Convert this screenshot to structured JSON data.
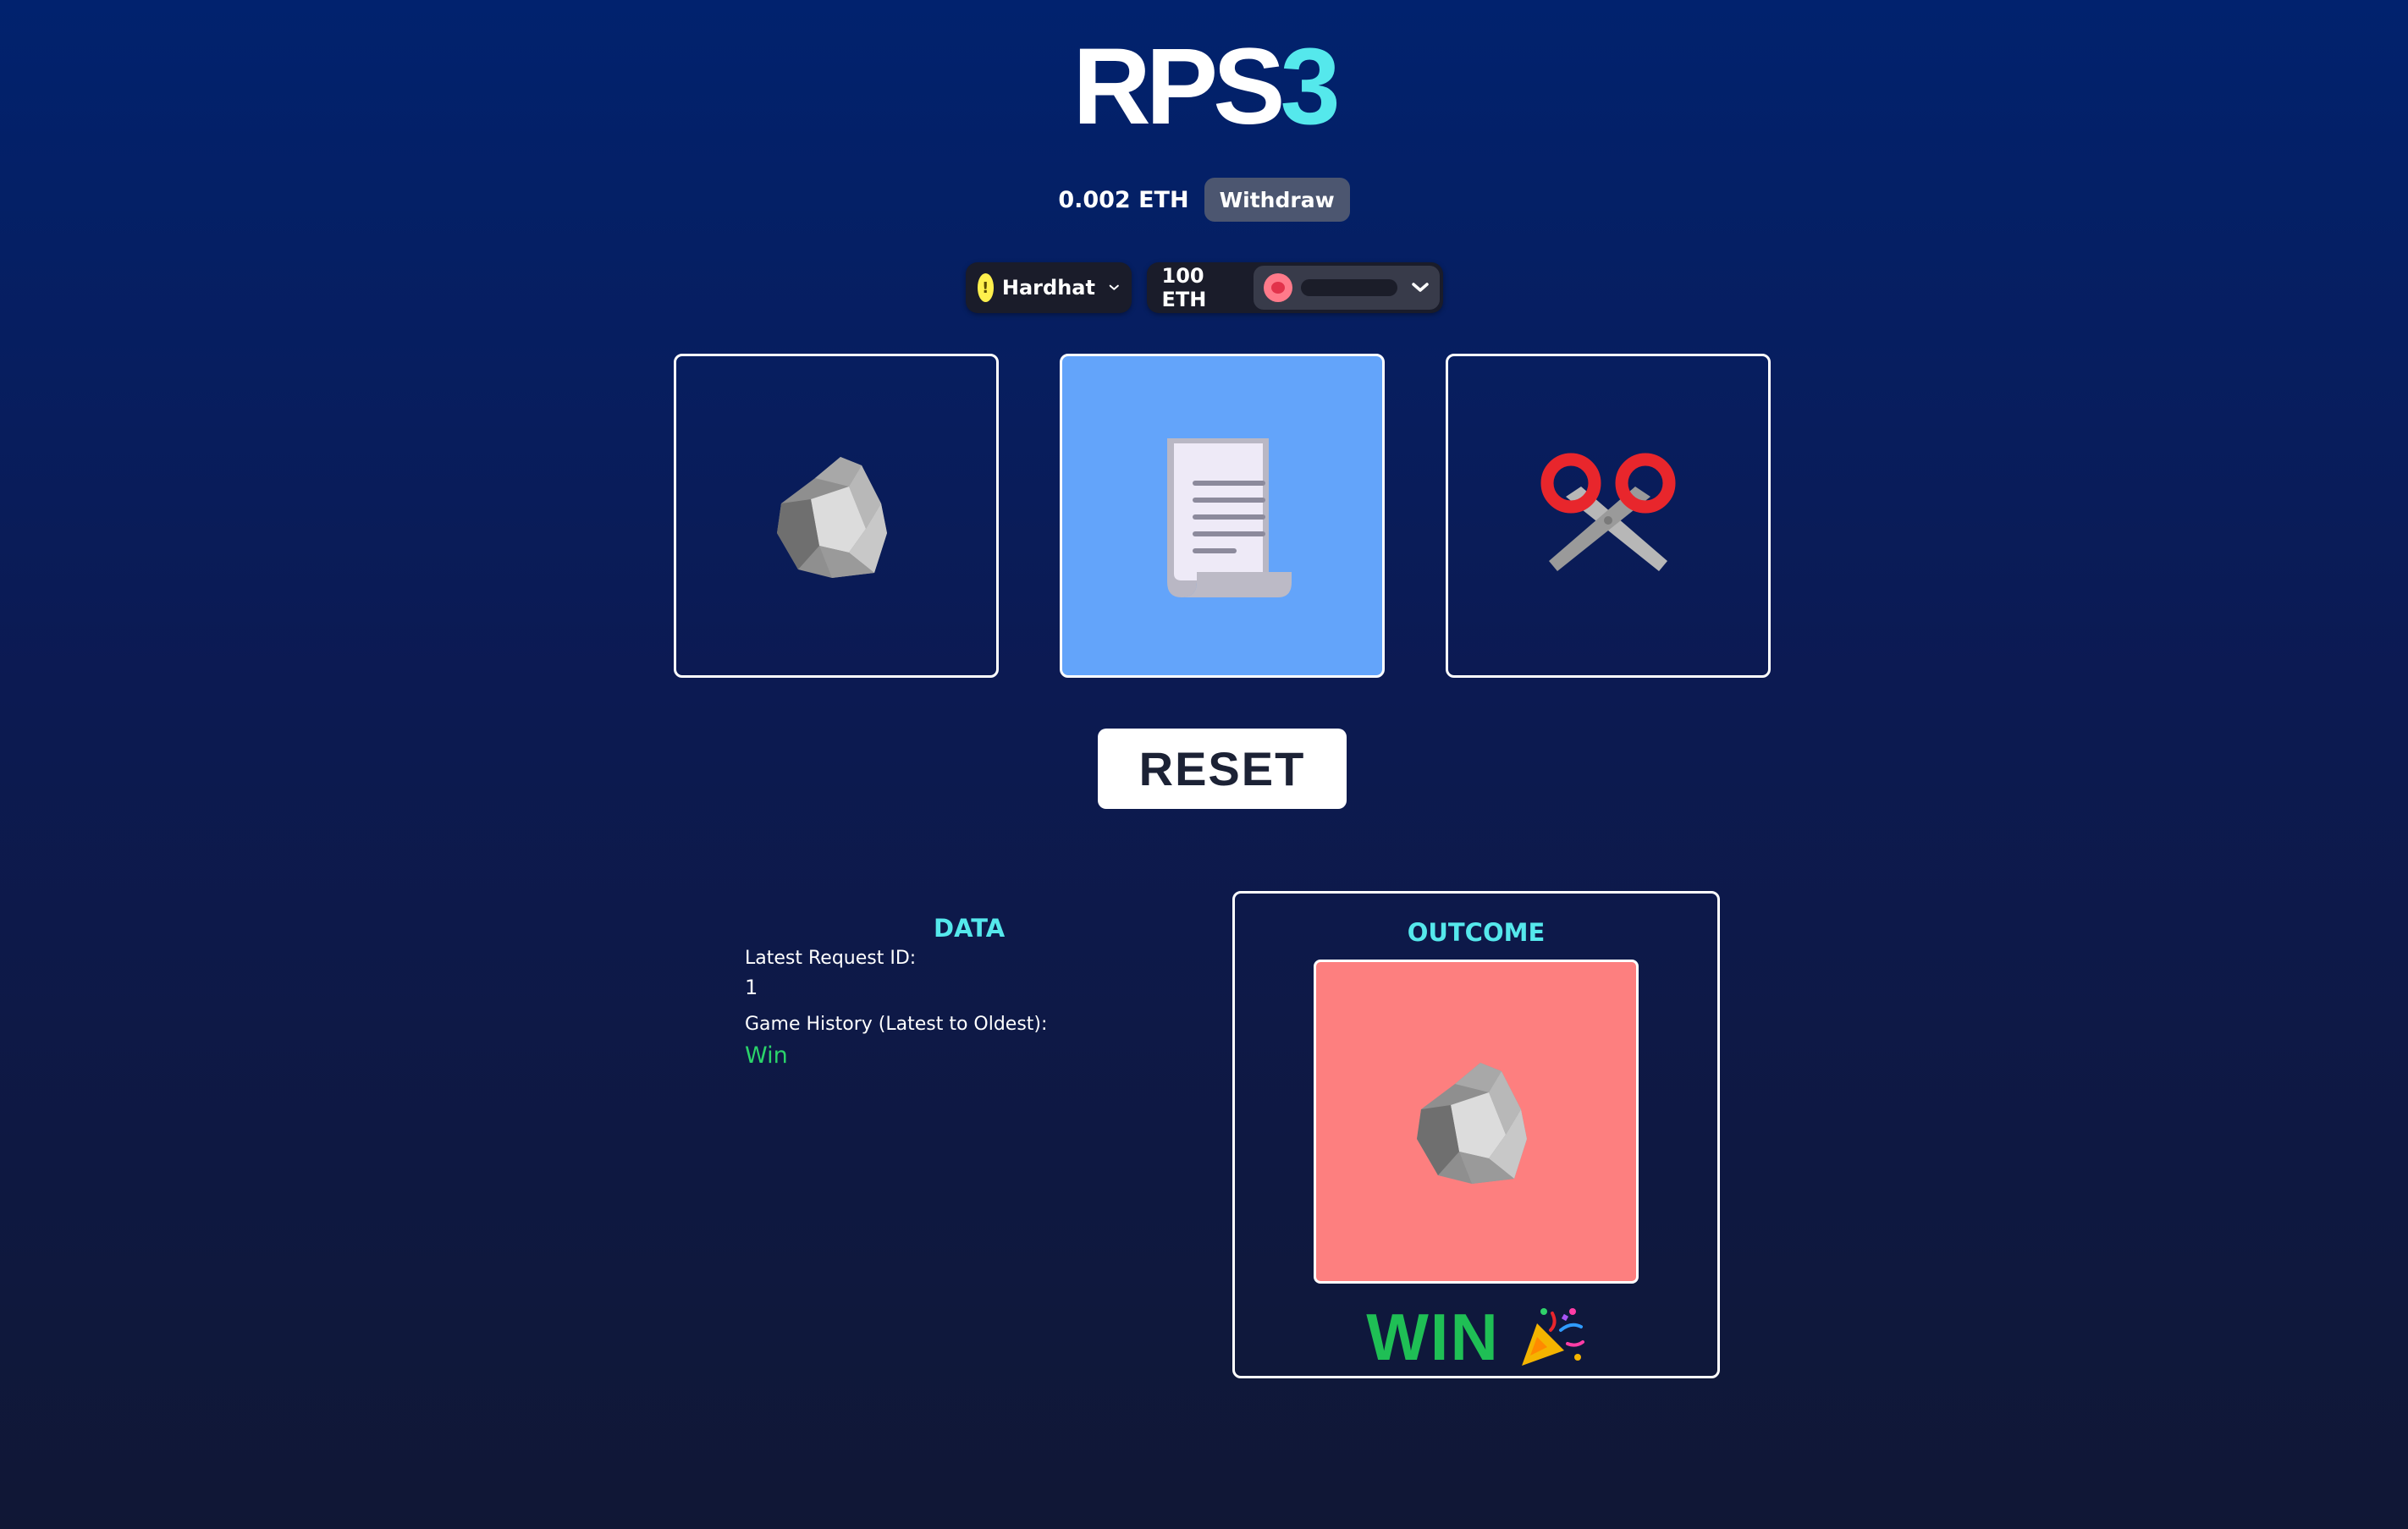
{
  "header": {
    "title_main": "RPS",
    "title_accent": "3"
  },
  "balance": {
    "amount": "0.002 ETH",
    "withdraw_label": "Withdraw"
  },
  "wallet": {
    "network_label": "Hardhat",
    "account_balance": "100 ETH"
  },
  "choices": [
    {
      "name": "rock",
      "icon": "rock-icon",
      "selected": false
    },
    {
      "name": "paper",
      "icon": "paper-icon",
      "selected": true
    },
    {
      "name": "scissors",
      "icon": "scissors-icon",
      "selected": false
    }
  ],
  "controls": {
    "reset_label": "RESET"
  },
  "data_panel": {
    "title": "DATA",
    "latest_request_label": "Latest Request ID:",
    "latest_request_value": "1",
    "history_label": "Game History (Latest to Oldest):",
    "history_value": "Win"
  },
  "outcome": {
    "title": "OUTCOME",
    "result_text": "WIN",
    "result_icon": "party-popper-icon",
    "opponent_choice_icon": "rock-icon"
  },
  "colors": {
    "accent": "#55e8ec",
    "selected_card": "#63a4fa",
    "outcome_card": "#fd7f7f",
    "win": "#1fbf55"
  }
}
